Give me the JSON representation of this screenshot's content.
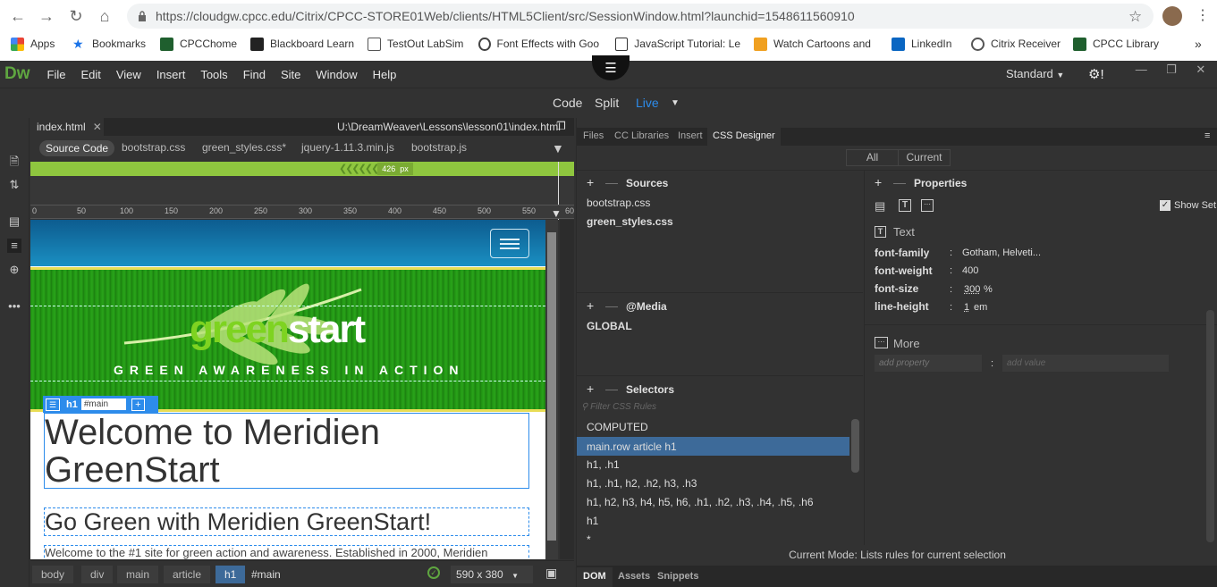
{
  "browser": {
    "url": "https://cloudgw.cpcc.edu/Citrix/CPCC-STORE01Web/clients/HTML5Client/src/SessionWindow.html?launchid=1548611560910",
    "bookmarks": [
      "Apps",
      "Bookmarks",
      "CPCChome",
      "Blackboard Learn",
      "TestOut LabSim",
      "Font Effects with Goo",
      "JavaScript Tutorial: Le",
      "Watch Cartoons and",
      "LinkedIn",
      "Citrix Receiver",
      "CPCC Library"
    ],
    "more": "»"
  },
  "menu": {
    "logo": "Dw",
    "items": [
      "File",
      "Edit",
      "View",
      "Insert",
      "Tools",
      "Find",
      "Site",
      "Window",
      "Help"
    ],
    "workspace": "Standard"
  },
  "views": {
    "code": "Code",
    "split": "Split",
    "live": "Live"
  },
  "doc": {
    "tab": "index.html",
    "path": "U:\\DreamWeaver\\Lessons\\lesson01\\index.html",
    "related": [
      "Source Code",
      "bootstrap.css",
      "green_styles.css*",
      "jquery-1.11.3.min.js",
      "bootstrap.js"
    ],
    "width_label": "426",
    "width_unit": "px",
    "ruler_ticks": [
      "0",
      "50",
      "100",
      "150",
      "200",
      "250",
      "300",
      "350",
      "400",
      "450",
      "500",
      "550",
      "60"
    ]
  },
  "page": {
    "logo_green": "green",
    "logo_start": "start",
    "tagline": "GREEN AWARENESS IN ACTION",
    "heading1": "Welcome to Meridien GreenStart",
    "heading2": "Go Green with Meridien GreenStart!",
    "para": "Welcome to the #1 site for green action and awareness. Established in 2000, Meridien",
    "element_tag": "h1",
    "element_id": "#main"
  },
  "status": {
    "crumbs": [
      "body",
      "div",
      "main",
      "article",
      "h1",
      "#main"
    ],
    "size": "590 x 380"
  },
  "panels": {
    "tabs": [
      "Files",
      "CC Libraries",
      "Insert",
      "CSS Designer"
    ],
    "all": "All",
    "current": "Current",
    "sources_title": "Sources",
    "sources": [
      "bootstrap.css",
      "green_styles.css"
    ],
    "media_title": "@Media",
    "media": "GLOBAL",
    "selectors_title": "Selectors",
    "filter_placeholder": "Filter CSS Rules",
    "selectors": [
      "COMPUTED",
      "main.row article h1",
      "h1, .h1",
      "h1, .h1, h2, .h2, h3, .h3",
      "h1, h2, h3, h4, h5, h6, .h1, .h2, .h3, .h4, .h5, .h6",
      "h1",
      "*"
    ],
    "properties_title": "Properties",
    "show_set": "Show Set",
    "text_title": "Text",
    "props": [
      {
        "name": "font-family",
        "value": "Gotham, Helveti...",
        "unit": ""
      },
      {
        "name": "font-weight",
        "value": "400",
        "unit": ""
      },
      {
        "name": "font-size",
        "value": "300",
        "unit": "%"
      },
      {
        "name": "line-height",
        "value": "1",
        "unit": "em"
      }
    ],
    "more_title": "More",
    "add_property": "add property",
    "add_value": "add value",
    "mode": "Current Mode: Lists rules for current selection",
    "bottom_tabs": [
      "DOM",
      "Assets",
      "Snippets"
    ]
  },
  "colors": {
    "accent": "#2d8ceb",
    "dw_green": "#5fa640",
    "selection": "#3d6a99"
  }
}
